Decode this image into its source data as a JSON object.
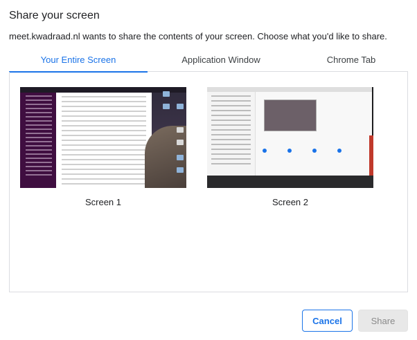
{
  "dialog": {
    "title": "Share your screen",
    "description": "meet.kwadraad.nl wants to share the contents of your screen. Choose what you'd like to share."
  },
  "tabs": [
    {
      "label": "Your Entire Screen",
      "active": true
    },
    {
      "label": "Application Window",
      "active": false
    },
    {
      "label": "Chrome Tab",
      "active": false
    }
  ],
  "screens": [
    {
      "label": "Screen 1"
    },
    {
      "label": "Screen 2"
    }
  ],
  "buttons": {
    "cancel": "Cancel",
    "share": "Share"
  },
  "colors": {
    "accent": "#1a73e8",
    "border": "#dadce0",
    "disabled_bg": "#e8e8e8",
    "disabled_text": "#8a8a8a"
  }
}
